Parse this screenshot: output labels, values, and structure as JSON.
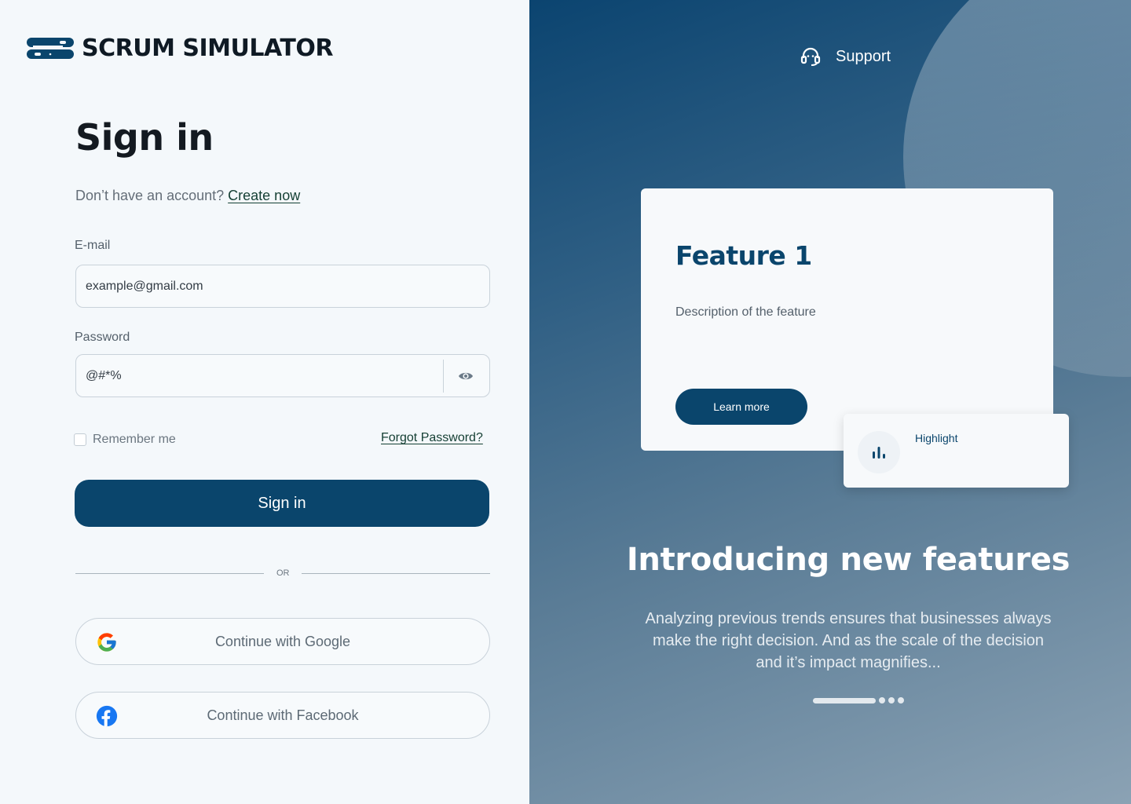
{
  "brand": {
    "name": "SCRUM SIMULATOR",
    "logo_icon": "scrum-simulator-logo",
    "color": "#0a456c"
  },
  "signin": {
    "title": "Sign in",
    "no_account_text": "Don’t have an account?",
    "create_link": "Create now",
    "email_label": "E-mail",
    "email_value": "example@gmail.com",
    "password_label": "Password",
    "password_value": "@#*%",
    "password_toggle_icon": "eye-icon",
    "remember_label": "Remember me",
    "forgot_link": "Forgot Password?",
    "submit_label": "Sign in",
    "or_text": "OR",
    "google_label": "Continue with Google",
    "facebook_label": "Continue with Facebook"
  },
  "promo": {
    "support_label": "Support",
    "support_icon": "headset-icon",
    "card_title": "Feature 1",
    "card_description": "Description of the feature",
    "learn_more_label": "Learn more",
    "highlight_label": "Highlight",
    "highlight_icon": "bar-chart-icon",
    "headline": "Introducing new features",
    "subtext": "Analyzing previous trends ensures that businesses always make the right decision. And as the scale of the decision and it’s impact magnifies...",
    "carousel_active_index": 0,
    "carousel_count": 4
  },
  "colors": {
    "primary": "#0a456c",
    "link": "#143f33",
    "panel_bg": "#f4f8fb"
  }
}
